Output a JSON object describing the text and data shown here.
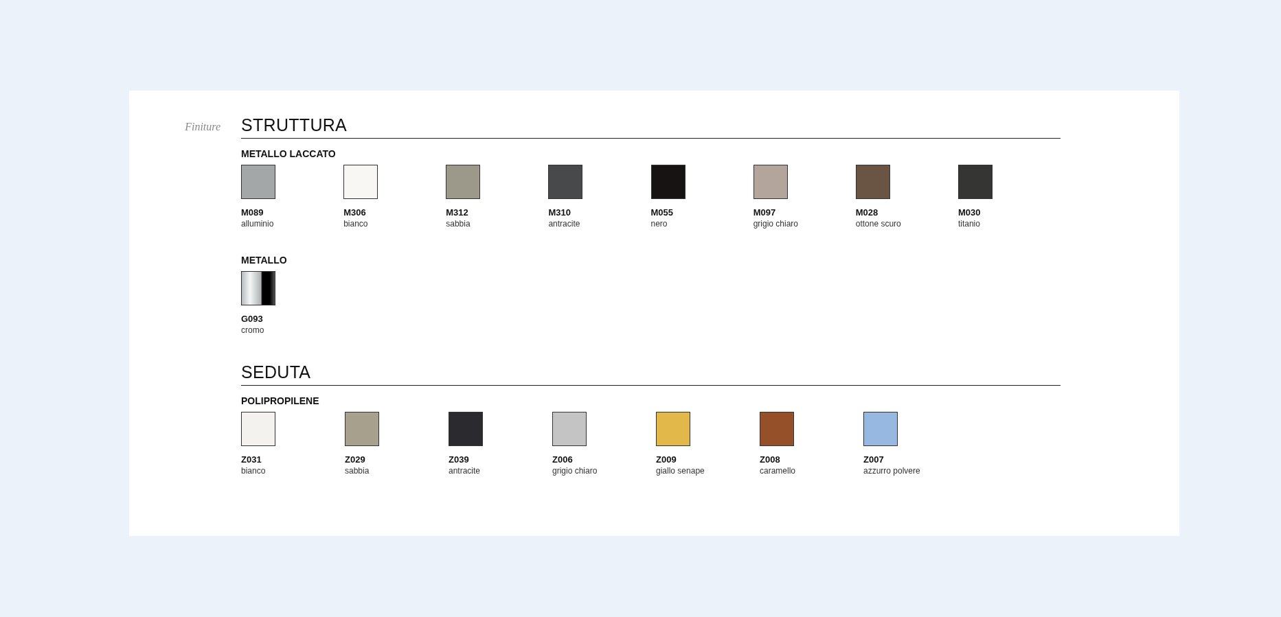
{
  "label": "Finiture",
  "sections": [
    {
      "title": "STRUTTURA",
      "groups": [
        {
          "title": "METALLO LACCATO",
          "swatches": [
            {
              "kind": "flat",
              "code": "M089",
              "name": "alluminio",
              "color": "#a3a7a8"
            },
            {
              "kind": "flat",
              "code": "M306",
              "name": "bianco",
              "color": "#f8f7f3"
            },
            {
              "kind": "flat",
              "code": "M312",
              "name": "sabbia",
              "color": "#9c998a"
            },
            {
              "kind": "flat",
              "code": "M310",
              "name": "antracite",
              "color": "#48494b"
            },
            {
              "kind": "flat",
              "code": "M055",
              "name": "nero",
              "color": "#161312"
            },
            {
              "kind": "flat",
              "code": "M097",
              "name": "grigio chiaro",
              "color": "#b3a59c"
            },
            {
              "kind": "flat",
              "code": "M028",
              "name": "ottone scuro",
              "color": "#6a5544"
            },
            {
              "kind": "flat",
              "code": "M030",
              "name": "titanio",
              "color": "#353633"
            }
          ]
        },
        {
          "title": "METALLO",
          "swatches": [
            {
              "kind": "chrome",
              "code": "G093",
              "name": "cromo"
            }
          ]
        }
      ]
    },
    {
      "title": "SEDUTA",
      "groups": [
        {
          "title": "POLIPROPILENE",
          "swatches": [
            {
              "kind": "flat",
              "code": "Z031",
              "name": "bianco",
              "color": "#f3f2ee"
            },
            {
              "kind": "flat",
              "code": "Z029",
              "name": "sabbia",
              "color": "#a6a08d"
            },
            {
              "kind": "flat",
              "code": "Z039",
              "name": "antracite",
              "color": "#2b2a2e"
            },
            {
              "kind": "flat",
              "code": "Z006",
              "name": "grigio chiaro",
              "color": "#c4c4c4"
            },
            {
              "kind": "flat",
              "code": "Z009",
              "name": "giallo senape",
              "color": "#e3b84a"
            },
            {
              "kind": "flat",
              "code": "Z008",
              "name": "caramello",
              "color": "#954f29"
            },
            {
              "kind": "flat",
              "code": "Z007",
              "name": "azzurro polvere",
              "color": "#97b9e1"
            }
          ]
        }
      ]
    }
  ]
}
